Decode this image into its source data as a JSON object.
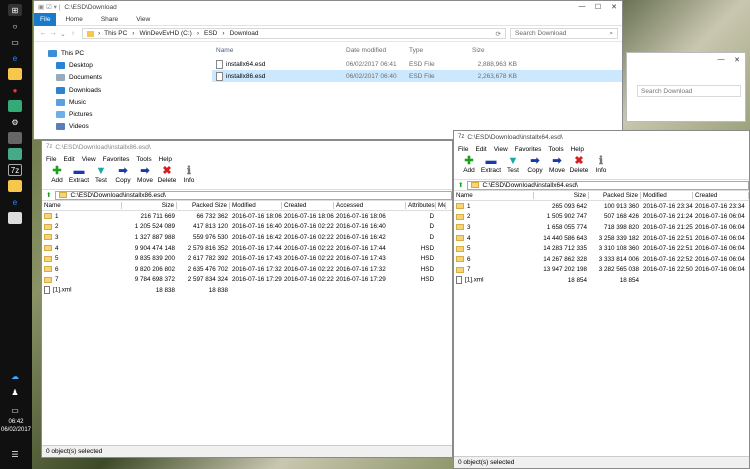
{
  "taskbar": {
    "time": "06:42",
    "date": "06/02/2017"
  },
  "explorer": {
    "title": "C:\\ESD\\Download",
    "ribbon": {
      "file": "File",
      "tabs": [
        "Home",
        "Share",
        "View"
      ]
    },
    "breadcrumb": [
      "This PC",
      "WinDevEvHD (C:)",
      "ESD",
      "Download"
    ],
    "search_placeholder": "Search Download",
    "nav": [
      "This PC",
      "Desktop",
      "Documents",
      "Downloads",
      "Music",
      "Pictures",
      "Videos"
    ],
    "columns": [
      "Name",
      "Date modified",
      "Type",
      "Size"
    ],
    "files": [
      {
        "name": "installx64.esd",
        "date": "06/02/2017 06:41",
        "type": "ESD File",
        "size": "2,888,963 KB"
      },
      {
        "name": "installx86.esd",
        "date": "06/02/2017 06:40",
        "type": "ESD File",
        "size": "2,263,678 KB"
      }
    ]
  },
  "bg_window": {
    "search_placeholder": "Search Download"
  },
  "zip_left": {
    "title": "C:\\ESD\\Download\\installx86.esd\\",
    "menu": [
      "File",
      "Edit",
      "View",
      "Favorites",
      "Tools",
      "Help"
    ],
    "toolbar": [
      "Add",
      "Extract",
      "Test",
      "Copy",
      "Move",
      "Delete",
      "Info"
    ],
    "path": "C:\\ESD\\Download\\installx86.esd\\",
    "columns": [
      "Name",
      "Size",
      "Packed Size",
      "Modified",
      "Created",
      "Accessed",
      "Attributes",
      "Me"
    ],
    "rows": [
      {
        "name": "1",
        "size": "216 711 669",
        "packed": "66 732 362",
        "modified": "2016-07-16 18:06",
        "created": "2016-07-16 18:06",
        "accessed": "2016-07-16 18:06",
        "attr": "D"
      },
      {
        "name": "2",
        "size": "1 205 524 089",
        "packed": "417 813 120",
        "modified": "2016-07-16 16:40",
        "created": "2016-07-16 02:22",
        "accessed": "2016-07-16 16:40",
        "attr": "D"
      },
      {
        "name": "3",
        "size": "1 327 887 988",
        "packed": "559 976 530",
        "modified": "2016-07-16 16:42",
        "created": "2016-07-16 02:22",
        "accessed": "2016-07-16 16:42",
        "attr": "D"
      },
      {
        "name": "4",
        "size": "9 904 474 148",
        "packed": "2 579 816 352",
        "modified": "2016-07-16 17:44",
        "created": "2016-07-16 02:22",
        "accessed": "2016-07-16 17:44",
        "attr": "HSD"
      },
      {
        "name": "5",
        "size": "9 835 839 200",
        "packed": "2 617 782 392",
        "modified": "2016-07-16 17:43",
        "created": "2016-07-16 02:22",
        "accessed": "2016-07-16 17:43",
        "attr": "HSD"
      },
      {
        "name": "6",
        "size": "9 820 206 802",
        "packed": "2 635 476 702",
        "modified": "2016-07-16 17:32",
        "created": "2016-07-16 02:22",
        "accessed": "2016-07-16 17:32",
        "attr": "HSD"
      },
      {
        "name": "7",
        "size": "9 784 698 372",
        "packed": "2 597 834 324",
        "modified": "2016-07-16 17:29",
        "created": "2016-07-16 02:22",
        "accessed": "2016-07-16 17:29",
        "attr": "HSD"
      },
      {
        "name": "[1].xml",
        "size": "18 838",
        "packed": "18 838",
        "modified": "",
        "created": "",
        "accessed": "",
        "attr": ""
      }
    ],
    "status": "0 object(s) selected"
  },
  "zip_right": {
    "title": "C:\\ESD\\Download\\installx64.esd\\",
    "menu": [
      "File",
      "Edit",
      "View",
      "Favorites",
      "Tools",
      "Help"
    ],
    "toolbar": [
      "Add",
      "Extract",
      "Test",
      "Copy",
      "Move",
      "Delete",
      "Info"
    ],
    "path": "C:\\ESD\\Download\\installx64.esd\\",
    "columns": [
      "Name",
      "Size",
      "Packed Size",
      "Modified",
      "Created"
    ],
    "rows": [
      {
        "name": "1",
        "size": "265 093 642",
        "packed": "100 913 360",
        "modified": "2016-07-16 23:34",
        "created": "2016-07-16 23:34"
      },
      {
        "name": "2",
        "size": "1 505 902 747",
        "packed": "507 168 426",
        "modified": "2016-07-16 21:24",
        "created": "2016-07-16 06:04"
      },
      {
        "name": "3",
        "size": "1 658 055 774",
        "packed": "718 398 820",
        "modified": "2016-07-16 21:25",
        "created": "2016-07-16 06:04"
      },
      {
        "name": "4",
        "size": "14 440 586 643",
        "packed": "3 258 339 182",
        "modified": "2016-07-16 22:51",
        "created": "2016-07-16 06:04"
      },
      {
        "name": "5",
        "size": "14 283 712 335",
        "packed": "3 310 108 360",
        "modified": "2016-07-16 22:51",
        "created": "2016-07-16 06:04"
      },
      {
        "name": "6",
        "size": "14 267 862 328",
        "packed": "3 333 814 006",
        "modified": "2016-07-16 22:52",
        "created": "2016-07-16 06:04"
      },
      {
        "name": "7",
        "size": "13 947 202 198",
        "packed": "3 282 565 038",
        "modified": "2016-07-16 22:50",
        "created": "2016-07-16 06:04"
      },
      {
        "name": "[1].xml",
        "size": "18 854",
        "packed": "18 854",
        "modified": "",
        "created": ""
      }
    ],
    "status": "0 object(s) selected"
  }
}
